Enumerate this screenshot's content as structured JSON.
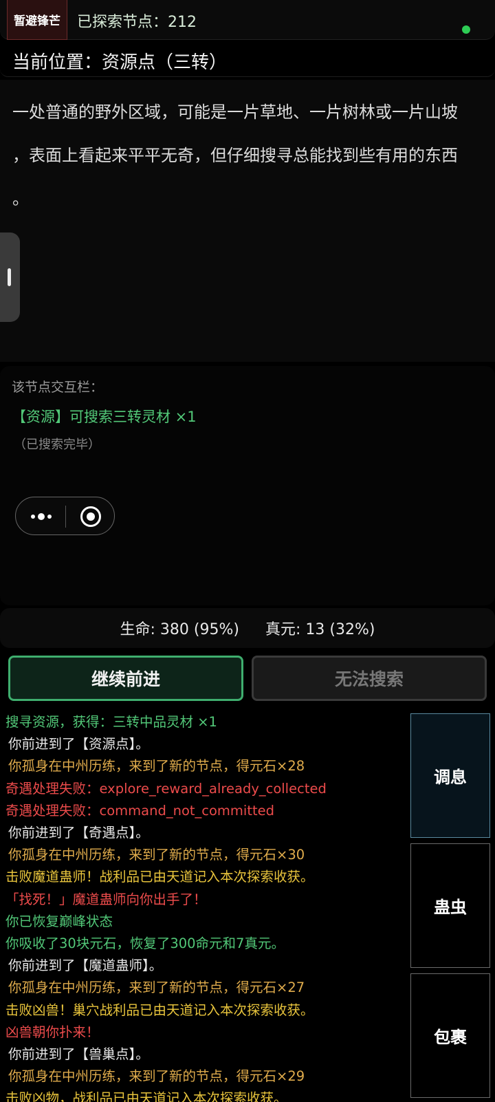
{
  "topbar": {
    "escape_label": "暂避锋芒",
    "explored_text": "已探索节点：212",
    "online_color": "#2ecc55"
  },
  "location": {
    "title": "当前位置：资源点（三转）"
  },
  "description": {
    "line1": "一处普通的野外区域，可能是一片草地、一片树林或一片山坡",
    "line2": "，表面上看起来平平无奇，但仔细搜寻总能找到些有用的东西",
    "line3": "。"
  },
  "interaction": {
    "title": "该节点交互栏：",
    "resource_line": "【资源】可搜索三转灵材 ×1",
    "searched_note": "（已搜索完毕）"
  },
  "capsule": {
    "more_icon": "more-dots-icon",
    "target_icon": "target-icon"
  },
  "stats": {
    "hp": "生命: 380 (95%)",
    "qi": "真元: 13 (32%)"
  },
  "buttons": {
    "advance": "继续前进",
    "search": "无法搜索"
  },
  "side_buttons": {
    "rest": "调息",
    "gu": "蛊虫",
    "bag": "包裹"
  },
  "log": [
    {
      "text": "搜寻资源，获得：三转中品灵材 ×1",
      "tone": "green"
    },
    {
      "text": "你前进到了【资源点】。",
      "tone": "white"
    },
    {
      "text": "你孤身在中州历练，来到了新的节点，得元石×28",
      "tone": "gold"
    },
    {
      "text": "奇遇处理失败：explore_reward_already_collected",
      "tone": "red"
    },
    {
      "text": "奇遇处理失败：command_not_committed",
      "tone": "red"
    },
    {
      "text": "你前进到了【奇遇点】。",
      "tone": "white"
    },
    {
      "text": "你孤身在中州历练，来到了新的节点，得元石×30",
      "tone": "gold"
    },
    {
      "text": "击败魔道蛊师！战利品已由天道记入本次探索收获。",
      "tone": "yellow"
    },
    {
      "text": "「找死！」魔道蛊师向你出手了！",
      "tone": "red2"
    },
    {
      "text": "你已恢复巅峰状态",
      "tone": "green"
    },
    {
      "text": "你吸收了30块元石，恢复了300命元和7真元。",
      "tone": "green"
    },
    {
      "text": "你前进到了【魔道蛊师】。",
      "tone": "white"
    },
    {
      "text": "你孤身在中州历练，来到了新的节点，得元石×27",
      "tone": "gold"
    },
    {
      "text": "击败凶兽！巢穴战利品已由天道记入本次探索收获。",
      "tone": "yellow"
    },
    {
      "text": "凶兽朝你扑来！",
      "tone": "red2"
    },
    {
      "text": "你前进到了【兽巢点】。",
      "tone": "white"
    },
    {
      "text": "你孤身在中州历练，来到了新的节点，得元石×29",
      "tone": "gold"
    },
    {
      "text": "击败凶物，战利品已由天道记入本次探索收获。",
      "tone": "yellow"
    }
  ]
}
